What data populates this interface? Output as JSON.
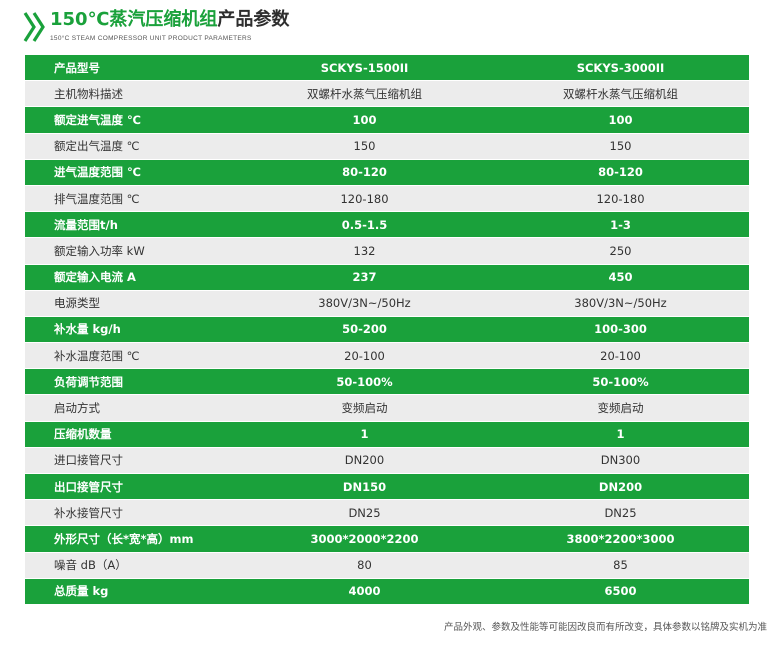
{
  "header": {
    "title_green": "150℃蒸汽压缩机组",
    "title_dark": "产品参数",
    "subtitle": "150°C STEAM COMPRESSOR UNIT PRODUCT PARAMETERS"
  },
  "colors": {
    "accent_green": "#1aa13b",
    "row_gray": "#ececec"
  },
  "table": {
    "rows": [
      {
        "label": "产品型号",
        "a": "SCKYS-1500II",
        "b": "SCKYS-3000II",
        "style": "green"
      },
      {
        "label": "主机物料描述",
        "a": "双螺杆水蒸气压缩机组",
        "b": "双螺杆水蒸气压缩机组",
        "style": "gray"
      },
      {
        "label": "额定进气温度 ℃",
        "a": "100",
        "b": "100",
        "style": "green"
      },
      {
        "label": "额定出气温度 ℃",
        "a": "150",
        "b": "150",
        "style": "gray"
      },
      {
        "label": "进气温度范围 ℃",
        "a": "80-120",
        "b": "80-120",
        "style": "green"
      },
      {
        "label": "排气温度范围 ℃",
        "a": "120-180",
        "b": "120-180",
        "style": "gray"
      },
      {
        "label": "流量范围t/h",
        "a": "0.5-1.5",
        "b": "1-3",
        "style": "green"
      },
      {
        "label": "额定输入功率 kW",
        "a": "132",
        "b": "250",
        "style": "gray"
      },
      {
        "label": "额定输入电流 A",
        "a": "237",
        "b": "450",
        "style": "green"
      },
      {
        "label": "电源类型",
        "a": "380V/3N~/50Hz",
        "b": "380V/3N~/50Hz",
        "style": "gray"
      },
      {
        "label": "补水量 kg/h",
        "a": "50-200",
        "b": "100-300",
        "style": "green"
      },
      {
        "label": "补水温度范围 ℃",
        "a": "20-100",
        "b": "20-100",
        "style": "gray"
      },
      {
        "label": "负荷调节范围",
        "a": "50-100%",
        "b": "50-100%",
        "style": "green"
      },
      {
        "label": "启动方式",
        "a": "变频启动",
        "b": "变频启动",
        "style": "gray"
      },
      {
        "label": "压缩机数量",
        "a": "1",
        "b": "1",
        "style": "green"
      },
      {
        "label": "进口接管尺寸",
        "a": "DN200",
        "b": "DN300",
        "style": "gray"
      },
      {
        "label": "出口接管尺寸",
        "a": "DN150",
        "b": "DN200",
        "style": "green"
      },
      {
        "label": "补水接管尺寸",
        "a": "DN25",
        "b": "DN25",
        "style": "gray"
      },
      {
        "label": "外形尺寸（长*宽*高）mm",
        "a": "3000*2000*2200",
        "b": "3800*2200*3000",
        "style": "green"
      },
      {
        "label": "噪音 dB（A）",
        "a": "80",
        "b": "85",
        "style": "gray"
      },
      {
        "label": "总质量 kg",
        "a": "4000",
        "b": "6500",
        "style": "green"
      }
    ]
  },
  "footnote": "产品外观、参数及性能等可能因改良而有所改变，具体参数以铭牌及实机为准"
}
